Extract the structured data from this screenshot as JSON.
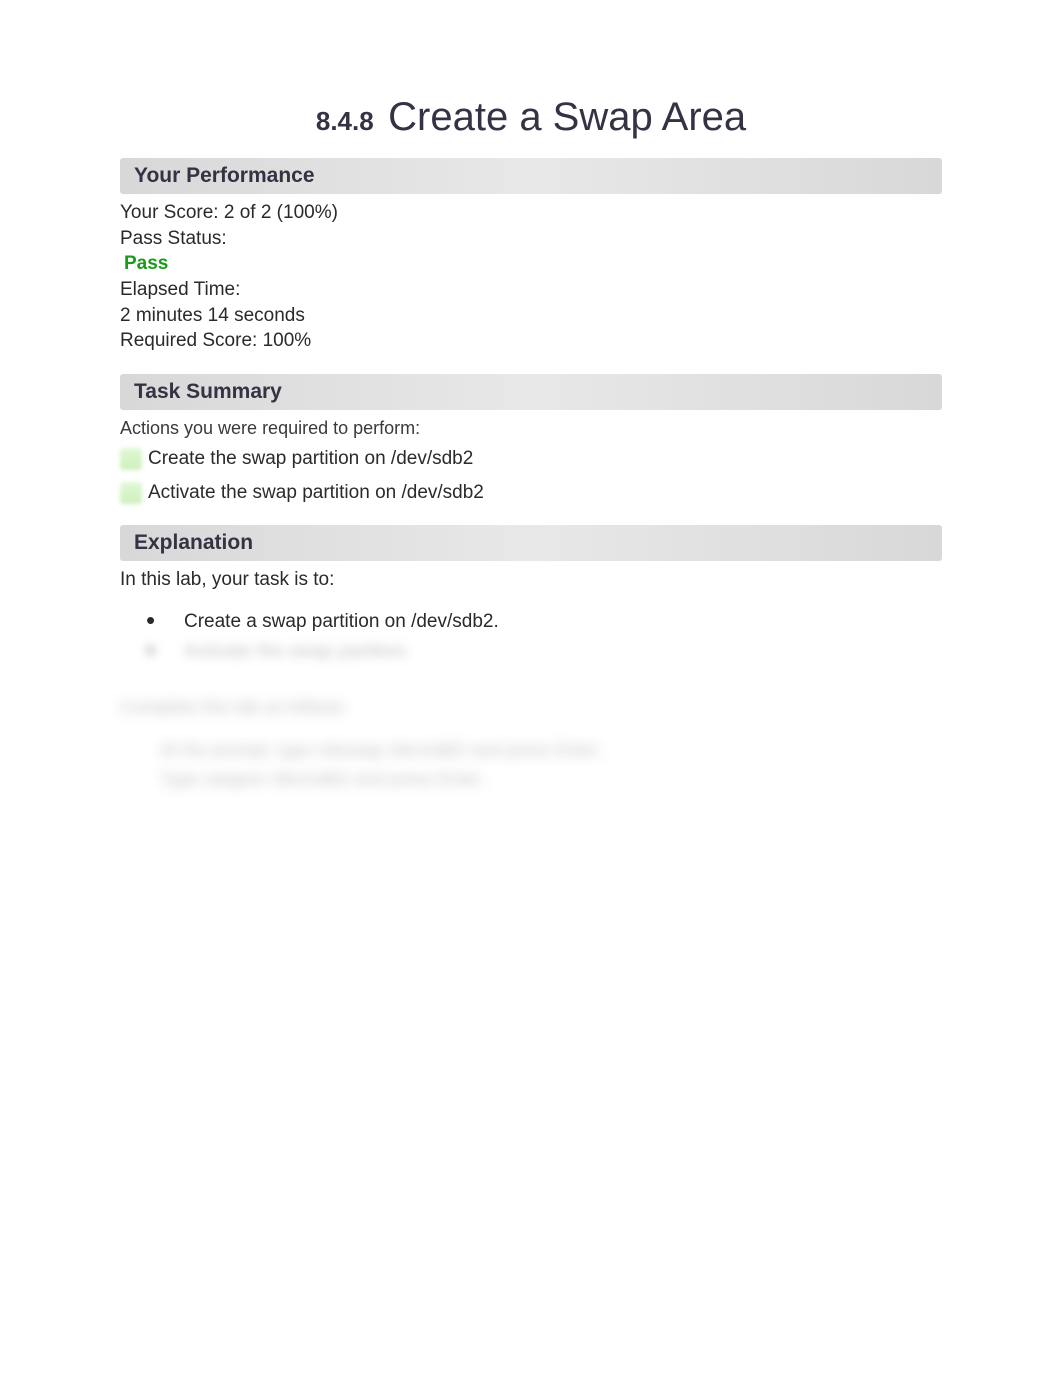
{
  "title": {
    "section_number": "8.4.8",
    "main": "Create a Swap Area"
  },
  "performance": {
    "header": "Your Performance",
    "score_label": "Your Score: 2 of 2 (100%)",
    "pass_status_label": "Pass Status:",
    "pass_status_value": "Pass",
    "elapsed_label": "Elapsed Time:",
    "elapsed_value": "2 minutes 14 seconds",
    "required_score": "Required Score: 100%"
  },
  "task_summary": {
    "header": "Task Summary",
    "intro": "Actions you were required to perform:",
    "items": [
      "Create the swap partition on /dev/sdb2",
      "Activate the swap partition on /dev/sdb2"
    ]
  },
  "explanation": {
    "header": "Explanation",
    "intro": "In this lab, your task is to:",
    "visible_item": "Create a swap partition on /dev/sdb2.",
    "blurred_item": "Activate the swap partition.",
    "blurred_paragraph": "Complete this lab as follows:",
    "blurred_steps": [
      "At the prompt, type  mkswap /dev/sdb2  and press  Enter .",
      "Type  swapon /dev/sdb2  and press  Enter ."
    ]
  }
}
